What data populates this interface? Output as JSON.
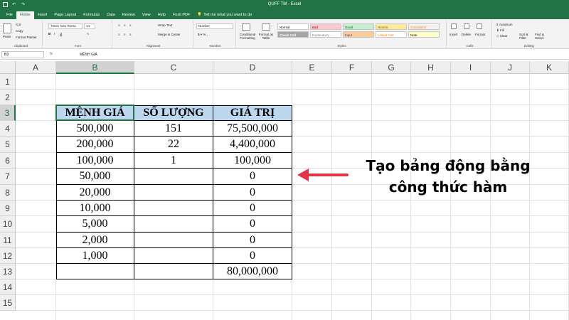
{
  "titlebar": {
    "title": "QUFF TM  -  Excel"
  },
  "tabs": [
    "File",
    "Home",
    "Insert",
    "Page Layout",
    "Formulas",
    "Data",
    "Review",
    "View",
    "Help",
    "Foxit PDF"
  ],
  "tell_me": "Tell me what you want to do",
  "ribbon": {
    "clipboard": {
      "paste": "Paste",
      "cut": "Cut",
      "copy": "Copy",
      "format_painter": "Format Painter",
      "label": "Clipboard"
    },
    "font": {
      "name": "Times New Roma",
      "size": "14",
      "label": "Font"
    },
    "alignment": {
      "wrap": "Wrap Text",
      "merge": "Merge & Center",
      "label": "Alignment"
    },
    "number": {
      "format": "Number",
      "label": "Number"
    },
    "styles": {
      "conditional": "Conditional Formatting",
      "format_table": "Format as Table",
      "cells": [
        "Normal",
        "Bad",
        "Good",
        "Neutral",
        "Calculation",
        "Check Cell",
        "Explanatory ...",
        "Input",
        "Linked Cell",
        "Note"
      ],
      "label": "Styles"
    },
    "cells": {
      "insert": "Insert",
      "delete": "Delete",
      "format": "Format",
      "label": "Cells"
    },
    "editing": {
      "autosum": "AutoSum",
      "fill": "Fill",
      "clear": "Clear",
      "sort": "Sort & Filter",
      "find": "Find & Select",
      "label": "Editing"
    }
  },
  "formula_bar": {
    "name_box": "B3",
    "fx": "fx",
    "content": "MỆNH GIÁ"
  },
  "columns": [
    "A",
    "B",
    "C",
    "D",
    "E",
    "F",
    "G",
    "H",
    "I",
    "J",
    "K"
  ],
  "rows": [
    "1",
    "2",
    "3",
    "4",
    "5",
    "6",
    "7",
    "8",
    "9",
    "10",
    "11",
    "12",
    "13",
    "14",
    "15"
  ],
  "table": {
    "headers": [
      "MỆNH GIÁ",
      "SỐ LƯỢNG",
      "GIÁ TRỊ"
    ],
    "rows": [
      [
        "500,000",
        "151",
        "75,500,000"
      ],
      [
        "200,000",
        "22",
        "4,400,000"
      ],
      [
        "100,000",
        "1",
        "100,000"
      ],
      [
        "50,000",
        "",
        "0"
      ],
      [
        "20,000",
        "",
        "0"
      ],
      [
        "10,000",
        "",
        "0"
      ],
      [
        "5,000",
        "",
        "0"
      ],
      [
        "2,000",
        "",
        "0"
      ],
      [
        "1,000",
        "",
        "0"
      ],
      [
        "",
        "",
        "80,000,000"
      ]
    ]
  },
  "annotation": {
    "line1": "Tạo bảng động bằng",
    "line2": "công thức hàm"
  },
  "colors": {
    "excel_green": "#217346",
    "header_fill": "#bdd7ee",
    "arrow": "#e0364a"
  }
}
